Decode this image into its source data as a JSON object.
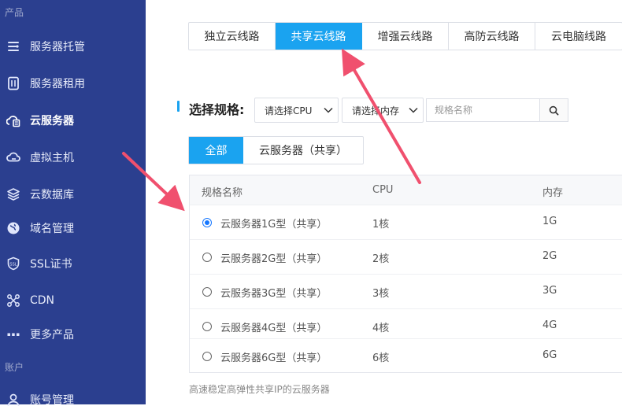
{
  "sidebar": {
    "section_products": "产品",
    "section_account": "账户",
    "items": [
      {
        "label": "服务器托管",
        "icon": "server-hosting-icon"
      },
      {
        "label": "服务器租用",
        "icon": "server-rental-icon"
      },
      {
        "label": "云服务器",
        "icon": "cloud-server-icon",
        "active": true
      },
      {
        "label": "虚拟主机",
        "icon": "virtual-host-icon"
      },
      {
        "label": "云数据库",
        "icon": "database-layers-icon"
      },
      {
        "label": "域名管理",
        "icon": "globe-icon"
      },
      {
        "label": "SSL证书",
        "icon": "ssl-shield-icon"
      },
      {
        "label": "CDN",
        "icon": "cdn-network-icon"
      },
      {
        "label": "更多产品",
        "icon": "more-dots-icon"
      },
      {
        "label": "账号管理",
        "icon": "user-icon"
      }
    ]
  },
  "line_tabs": [
    "独立云线路",
    "共享云线路",
    "增强云线路",
    "高防云线路",
    "云电脑线路"
  ],
  "line_tab_active": "共享云线路",
  "spec": {
    "title": "选择规格:",
    "cpu_select": "请选择CPU",
    "mem_select": "请选择内存",
    "search_placeholder": "规格名称"
  },
  "filter_tabs": {
    "all": "全部",
    "shared": "云服务器（共享）"
  },
  "table": {
    "headers": {
      "name": "规格名称",
      "cpu": "CPU",
      "mem": "内存"
    },
    "rows": [
      {
        "name": "云服务器1G型（共享）",
        "cpu": "1核",
        "mem": "1G",
        "selected": true
      },
      {
        "name": "云服务器2G型（共享）",
        "cpu": "2核",
        "mem": "2G",
        "selected": false
      },
      {
        "name": "云服务器3G型（共享）",
        "cpu": "3核",
        "mem": "3G",
        "selected": false
      },
      {
        "name": "云服务器4G型（共享）",
        "cpu": "4核",
        "mem": "4G",
        "selected": false
      },
      {
        "name": "云服务器6G型（共享）",
        "cpu": "6核",
        "mem": "6G",
        "selected": false
      }
    ]
  },
  "note": "高速稳定高弹性共享IP的云服务器",
  "colors": {
    "sidebar": "#2b3f8f",
    "accent": "#1aa3f0",
    "annotation": "#f0506e"
  }
}
